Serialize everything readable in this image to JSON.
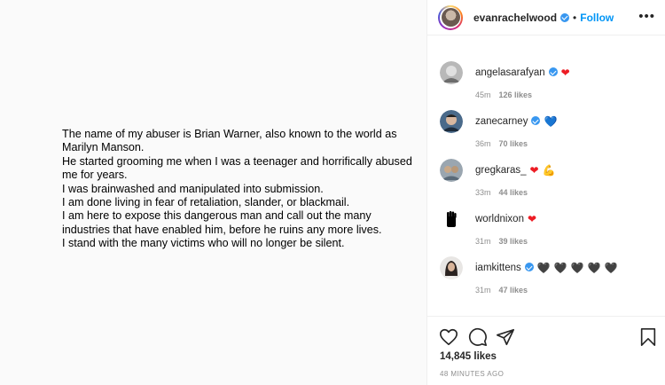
{
  "post_text": {
    "lines": [
      "The name of my abuser is Brian Warner, also known to the world as Marilyn Manson.",
      "He started grooming me when I was a teenager and horrifically abused me for years.",
      "I was brainwashed and manipulated into submission.",
      "I am done living in fear of retaliation, slander, or blackmail.",
      "I am here to expose this dangerous man and call out the many industries that have enabled him, before he ruins any more lives.",
      "I stand with the many victims who will no longer be silent."
    ]
  },
  "header": {
    "username": "evanrachelwood",
    "separator": "•",
    "follow_label": "Follow",
    "more_label": "•••",
    "avatar_icon": "profile-avatar"
  },
  "comments": [
    {
      "username": "angelasarafyan",
      "verified": true,
      "emojis": [
        "❤"
      ],
      "time": "45m",
      "likes": "126 likes"
    },
    {
      "username": "zanecarney",
      "verified": true,
      "emojis": [
        "💙"
      ],
      "time": "36m",
      "likes": "70 likes"
    },
    {
      "username": "gregkaras_",
      "verified": false,
      "emojis": [
        "❤",
        "💪"
      ],
      "time": "33m",
      "likes": "44 likes"
    },
    {
      "username": "worldnixon",
      "verified": false,
      "emojis": [
        "❤"
      ],
      "time": "31m",
      "likes": "39 likes"
    },
    {
      "username": "iamkittens",
      "verified": true,
      "emojis": [
        "🖤",
        "🖤",
        "🖤",
        "🖤",
        "🖤"
      ],
      "time": "31m",
      "likes": "47 likes"
    }
  ],
  "actions": {
    "like_icon": "heart-outline-icon",
    "comment_icon": "comment-bubble-icon",
    "share_icon": "paper-plane-icon",
    "save_icon": "bookmark-icon",
    "likes_count": "14,845 likes",
    "time_ago": "48 MINUTES AGO"
  },
  "colors": {
    "link_blue": "#0095f6",
    "verified_blue": "#3897f0",
    "heart_red": "#ed1c24",
    "muted_gray": "#8e8e8e"
  }
}
